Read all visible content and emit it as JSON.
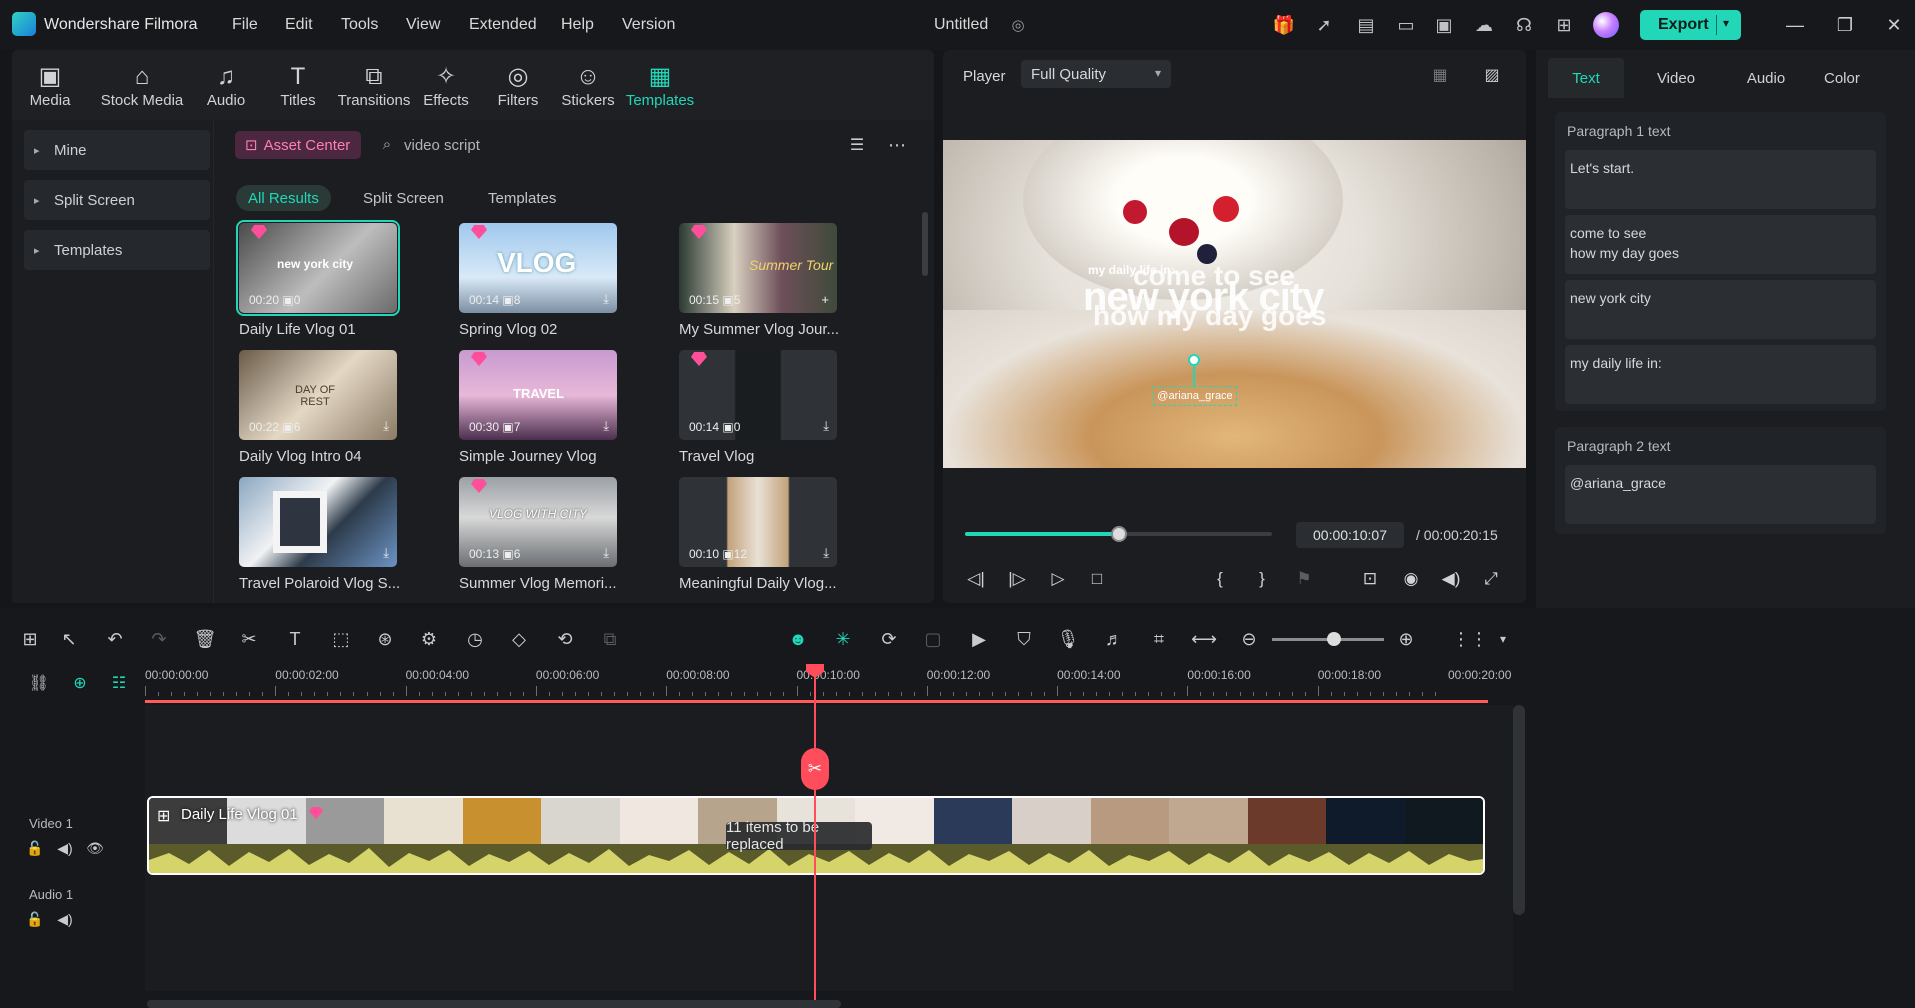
{
  "app": {
    "name": "Wondershare Filmora",
    "doc_title": "Untitled",
    "menu": [
      "File",
      "Edit",
      "Tools",
      "View",
      "Extended",
      "Help",
      "Version"
    ],
    "export_label": "Export",
    "accent": "#21d7b7"
  },
  "media_tabs": [
    "Media",
    "Stock Media",
    "Audio",
    "Titles",
    "Transitions",
    "Effects",
    "Filters",
    "Stickers",
    "Templates"
  ],
  "sidebar": {
    "items": [
      "Mine",
      "Split Screen",
      "Templates"
    ]
  },
  "search": {
    "asset_center": "Asset Center",
    "query": "video script"
  },
  "filter_tabs": [
    "All Results",
    "Split Screen",
    "Templates"
  ],
  "templates": [
    {
      "title": "Daily Life Vlog 01",
      "duration": "00:20",
      "count": "0",
      "thumb_text": "new york city"
    },
    {
      "title": "Spring Vlog 02",
      "duration": "00:14",
      "count": "8",
      "thumb_text": "VLOG"
    },
    {
      "title": "My Summer Vlog Jour...",
      "duration": "00:15",
      "count": "5",
      "thumb_text": "Summer Tour"
    },
    {
      "title": "Daily Vlog Intro 04",
      "duration": "00:22",
      "count": "6",
      "thumb_text": "DAY OF REST"
    },
    {
      "title": "Simple Journey Vlog",
      "duration": "00:30",
      "count": "7",
      "thumb_text": "TRAVEL"
    },
    {
      "title": "Travel Vlog",
      "duration": "00:14",
      "count": "0",
      "thumb_text": ""
    },
    {
      "title": "Travel Polaroid Vlog S...",
      "duration": "",
      "count": "",
      "thumb_text": ""
    },
    {
      "title": "Summer Vlog Memori...",
      "duration": "00:13",
      "count": "6",
      "thumb_text": "VLOG WITH CITY"
    },
    {
      "title": "Meaningful Daily Vlog...",
      "duration": "00:10",
      "count": "12",
      "thumb_text": ""
    }
  ],
  "player": {
    "label": "Player",
    "quality": "Full Quality",
    "current_time": "00:00:10:07",
    "total_time": "/ 00:00:20:15",
    "progress": 0.5,
    "overlay": {
      "small": "my daily life in:",
      "big1": "new york city",
      "big2": "come to see",
      "big3": "how my day goes",
      "handle": "@ariana_grace"
    }
  },
  "props": {
    "tabs": [
      "Text",
      "Video",
      "Audio",
      "Color"
    ],
    "group1_title": "Paragraph 1 text",
    "group1_fields": [
      "Let's start.",
      "come to see\nhow my day goes",
      "new york city",
      "my daily life in:"
    ],
    "group2_title": "Paragraph 2 text",
    "group2_fields": [
      "@ariana_grace"
    ]
  },
  "timeline": {
    "ticks": [
      "00:00:00:00",
      "00:00:02:00",
      "00:00:04:00",
      "00:00:06:00",
      "00:00:08:00",
      "00:00:10:00",
      "00:00:12:00",
      "00:00:14:00",
      "00:00:16:00",
      "00:00:18:00",
      "00:00:20:00"
    ],
    "video_track": "Video 1",
    "audio_track": "Audio 1",
    "clip_title": "Daily Life Vlog 01",
    "replace_badge": "11 items to be replaced",
    "zoom": 0.55
  }
}
